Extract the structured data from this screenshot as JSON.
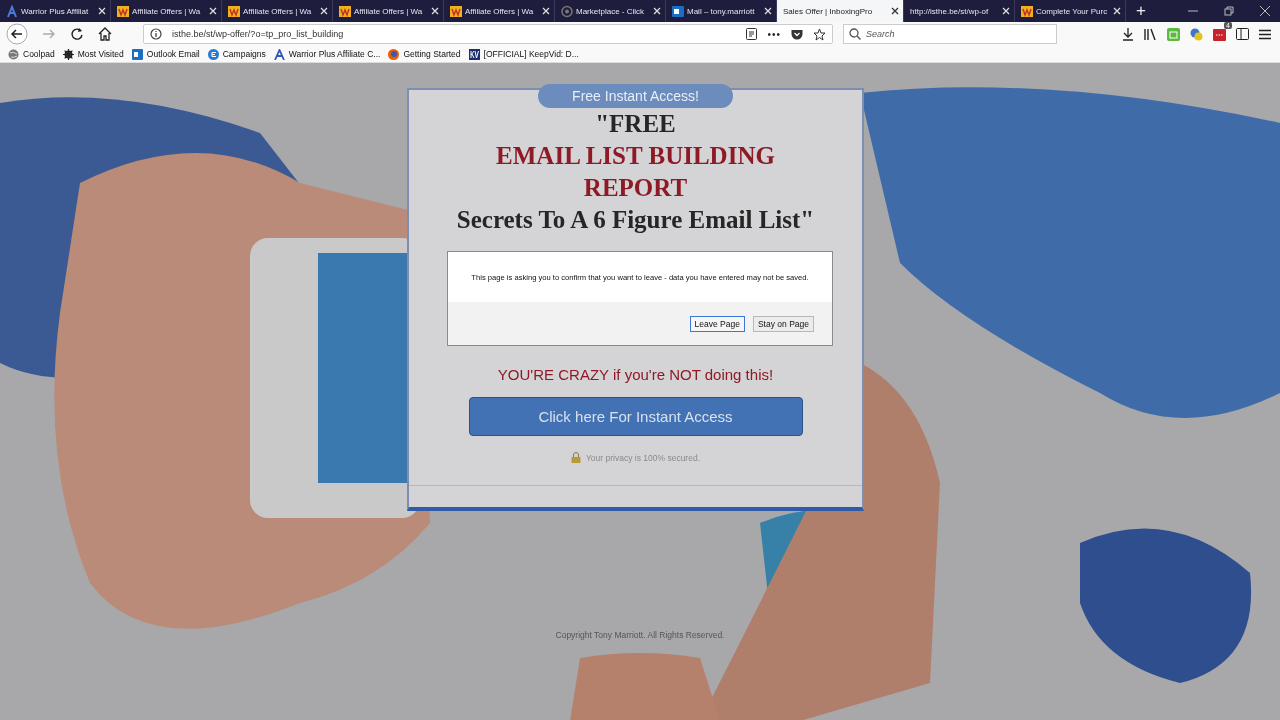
{
  "tabs": [
    {
      "title": "Warrior Plus Affiliat",
      "selected": false
    },
    {
      "title": "Affiliate Offers | Wa",
      "selected": false
    },
    {
      "title": "Affiliate Offers | Wa",
      "selected": false
    },
    {
      "title": "Affiliate Offers | Wa",
      "selected": false
    },
    {
      "title": "Affiliate Offers | Wa",
      "selected": false
    },
    {
      "title": "Marketplace - Click",
      "selected": false
    },
    {
      "title": "Mail – tony.marriott",
      "selected": false
    },
    {
      "title": "Sales Offer | InboxingPro",
      "selected": true
    },
    {
      "title": "http://isthe.be/st/wp-of",
      "selected": false
    },
    {
      "title": "Complete Your Purc",
      "selected": false
    }
  ],
  "new_tab": "+",
  "address_bar": {
    "url": "isthe.be/st/wp-offer/?o=tp_pro_list_building"
  },
  "overflow_menu": "•••",
  "search": {
    "placeholder": "Search"
  },
  "extension_badge": "4",
  "bookmarks": [
    "Coolpad",
    "Most Visited",
    "Outlook Email",
    "Campaigns",
    "Warrior Plus Affiliate C...",
    "Getting Started",
    "[OFFICIAL] KeepVid: D..."
  ],
  "page": {
    "ribbon": "Free Instant Access!",
    "headline": [
      {
        "text": "\"FREE",
        "kind": "plain"
      },
      {
        "text": "EMAIL LIST BUILDING",
        "kind": "accent"
      },
      {
        "text": "REPORT",
        "kind": "accent"
      },
      {
        "text": "Secrets To A 6 Figure Email List\"",
        "kind": "plain"
      }
    ],
    "warning": "YOU'RE CRAZY if you're NOT doing this!",
    "cta_button": "Click here For Instant Access",
    "privacy_note": "Your privacy is 100% secured.",
    "copyright": "Copyright Tony Marriott. All Rights Reserved."
  },
  "dialog": {
    "message": "This page is asking you to confirm that you want to leave - data you have entered may not be saved.",
    "buttons": [
      {
        "label": "Leave Page",
        "focused": true
      },
      {
        "label": "Stay on Page",
        "focused": false
      }
    ]
  }
}
